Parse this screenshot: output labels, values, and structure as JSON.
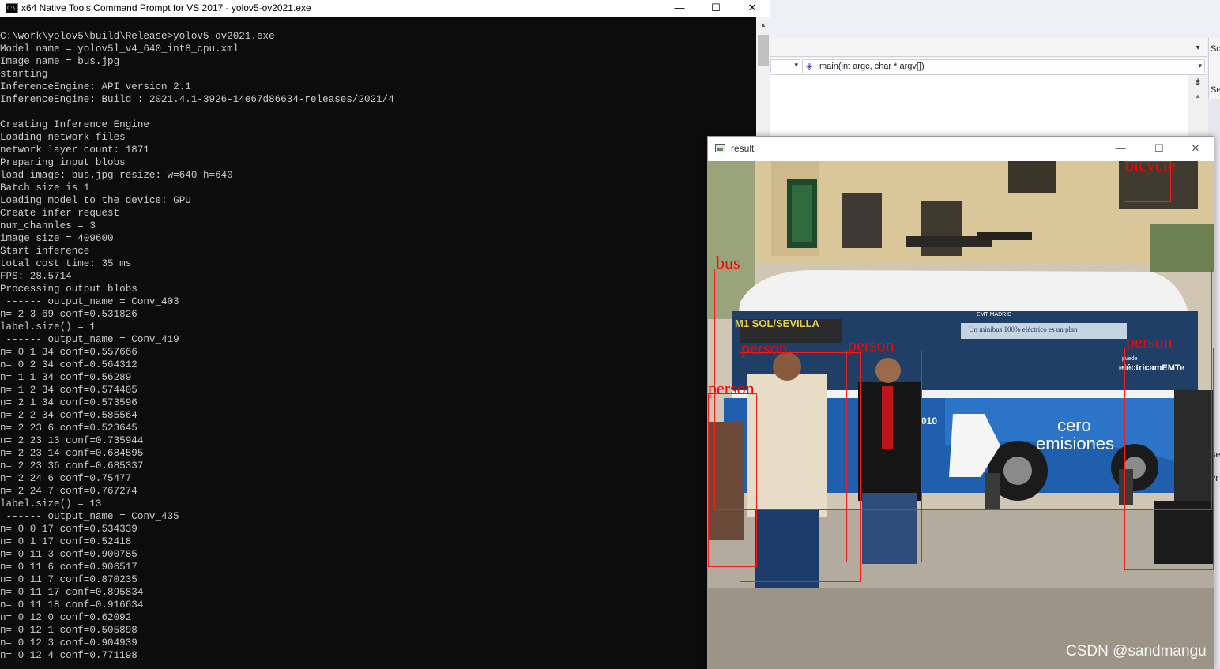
{
  "ide": {
    "function_nav": "main(int argc, char * argv[])",
    "function_icon": "function-icon",
    "side_labels": [
      "Sc",
      "Se",
      "Se",
      "Pr"
    ]
  },
  "console": {
    "title": "x64 Native Tools Command Prompt for VS 2017 - yolov5-ov2021.exe",
    "icon": "command-prompt-icon",
    "cmd_icon_text": "C:\\",
    "lines": [
      "",
      "C:\\work\\yolov5\\build\\Release>yolov5-ov2021.exe",
      "Model name = yolov5l_v4_640_int8_cpu.xml",
      "Image name = bus.jpg",
      "starting",
      "InferenceEngine: API version 2.1",
      "InferenceEngine: Build : 2021.4.1-3926-14e67d86634-releases/2021/4",
      "",
      "Creating Inference Engine",
      "Loading network files",
      "network layer count: 1871",
      "Preparing input blobs",
      "load image: bus.jpg resize: w=640 h=640",
      "Batch size is 1",
      "Loading model to the device: GPU",
      "Create infer request",
      "num_channles = 3",
      "image_size = 409600",
      "Start inference",
      "total cost time: 35 ms",
      "FPS: 28.5714",
      "Processing output blobs",
      " ------ output_name = Conv_403",
      "n= 2 3 69 conf=0.531826",
      "label.size() = 1",
      " ------ output_name = Conv_419",
      "n= 0 1 34 conf=0.557666",
      "n= 0 2 34 conf=0.564312",
      "n= 1 1 34 conf=0.56289",
      "n= 1 2 34 conf=0.574405",
      "n= 2 1 34 conf=0.573596",
      "n= 2 2 34 conf=0.585564",
      "n= 2 23 6 conf=0.523645",
      "n= 2 23 13 conf=0.735944",
      "n= 2 23 14 conf=0.684595",
      "n= 2 23 36 conf=0.685337",
      "n= 2 24 6 conf=0.75477",
      "n= 2 24 7 conf=0.767274",
      "label.size() = 13",
      " ------ output_name = Conv_435",
      "n= 0 0 17 conf=0.534339",
      "n= 0 1 17 conf=0.52418",
      "n= 0 11 3 conf=0.900785",
      "n= 0 11 6 conf=0.906517",
      "n= 0 11 7 conf=0.870235",
      "n= 0 11 17 conf=0.895834",
      "n= 0 11 18 conf=0.916634",
      "n= 0 12 0 conf=0.62092",
      "n= 0 12 1 conf=0.505898",
      "n= 0 12 3 conf=0.904939",
      "n= 0 12 4 conf=0.771198"
    ]
  },
  "result_window": {
    "title": "result",
    "detections": [
      {
        "label": "bicycle"
      },
      {
        "label": "bus"
      },
      {
        "label": "person"
      },
      {
        "label": "person"
      },
      {
        "label": "person"
      },
      {
        "label": "person"
      }
    ],
    "scene_text": {
      "route_sign": "M1 SOL/SEVILLA",
      "bus_ad": "Un minibus 100% eléctrico es un plan",
      "bus_brand": "eléctricamEMTe",
      "bus_brand_top": "puede",
      "bus_cero": "cero",
      "bus_emisiones": "emisiones",
      "bus_number": "010",
      "emt": "EMT MADRID"
    }
  },
  "watermark": "CSDN @sandmangu",
  "colors": {
    "console_bg": "#0c0c0c",
    "console_text": "#cccccc",
    "detection": "#ff0000",
    "bus_blue": "#1f5fae"
  }
}
